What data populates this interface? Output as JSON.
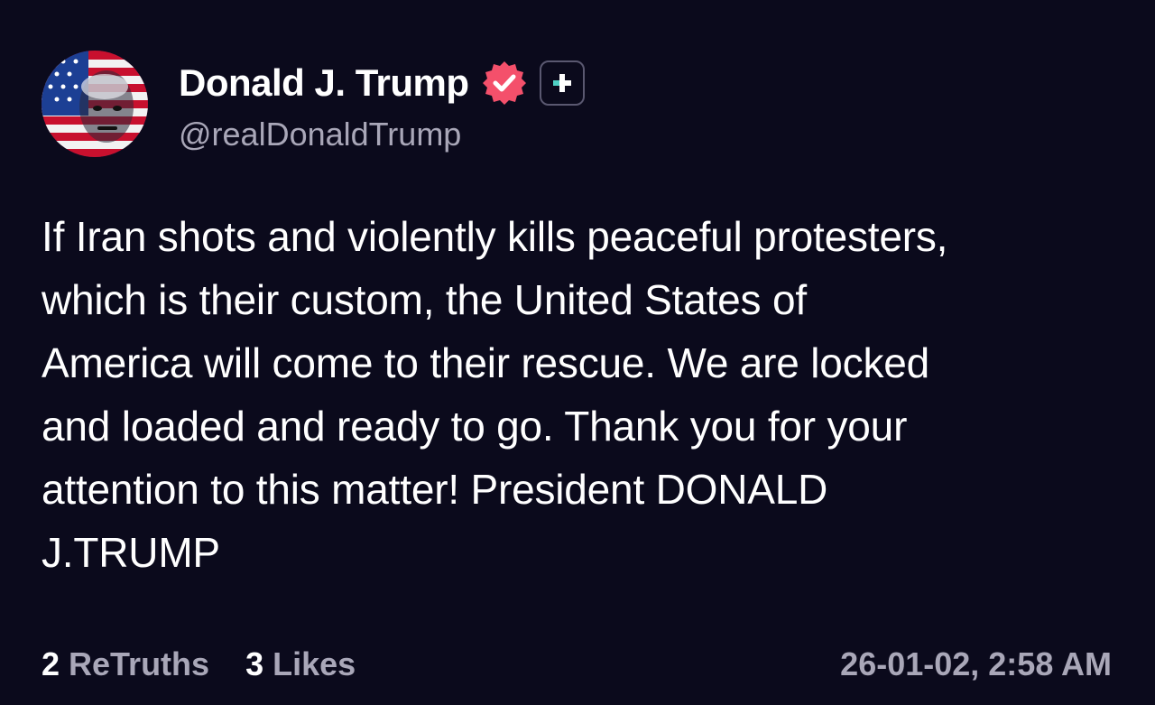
{
  "author": {
    "display_name": "Donald J. Trump",
    "handle": "@realDonaldTrump",
    "verified_icon": "verified-check-icon",
    "plus_icon": "plus-icon",
    "avatar_icon": "avatar-flag-portrait",
    "verified_color": "#f4506b",
    "plus_color": "#4fd1c5"
  },
  "post": {
    "text": "If Iran shots and violently kills peaceful protesters,\nwhich is their custom, the United States of\nAmerica will come to their rescue. We are locked\nand loaded and ready to go. Thank you for your\nattention to this matter! President DONALD\nJ.TRUMP"
  },
  "stats": {
    "retruths_count": "2",
    "retruths_label": "ReTruths",
    "likes_count": "3",
    "likes_label": "Likes"
  },
  "timestamp": "26-01-02, 2:58 AM",
  "colors": {
    "background": "#0b0a1c",
    "text": "#ffffff",
    "muted": "#a9a7b8"
  }
}
